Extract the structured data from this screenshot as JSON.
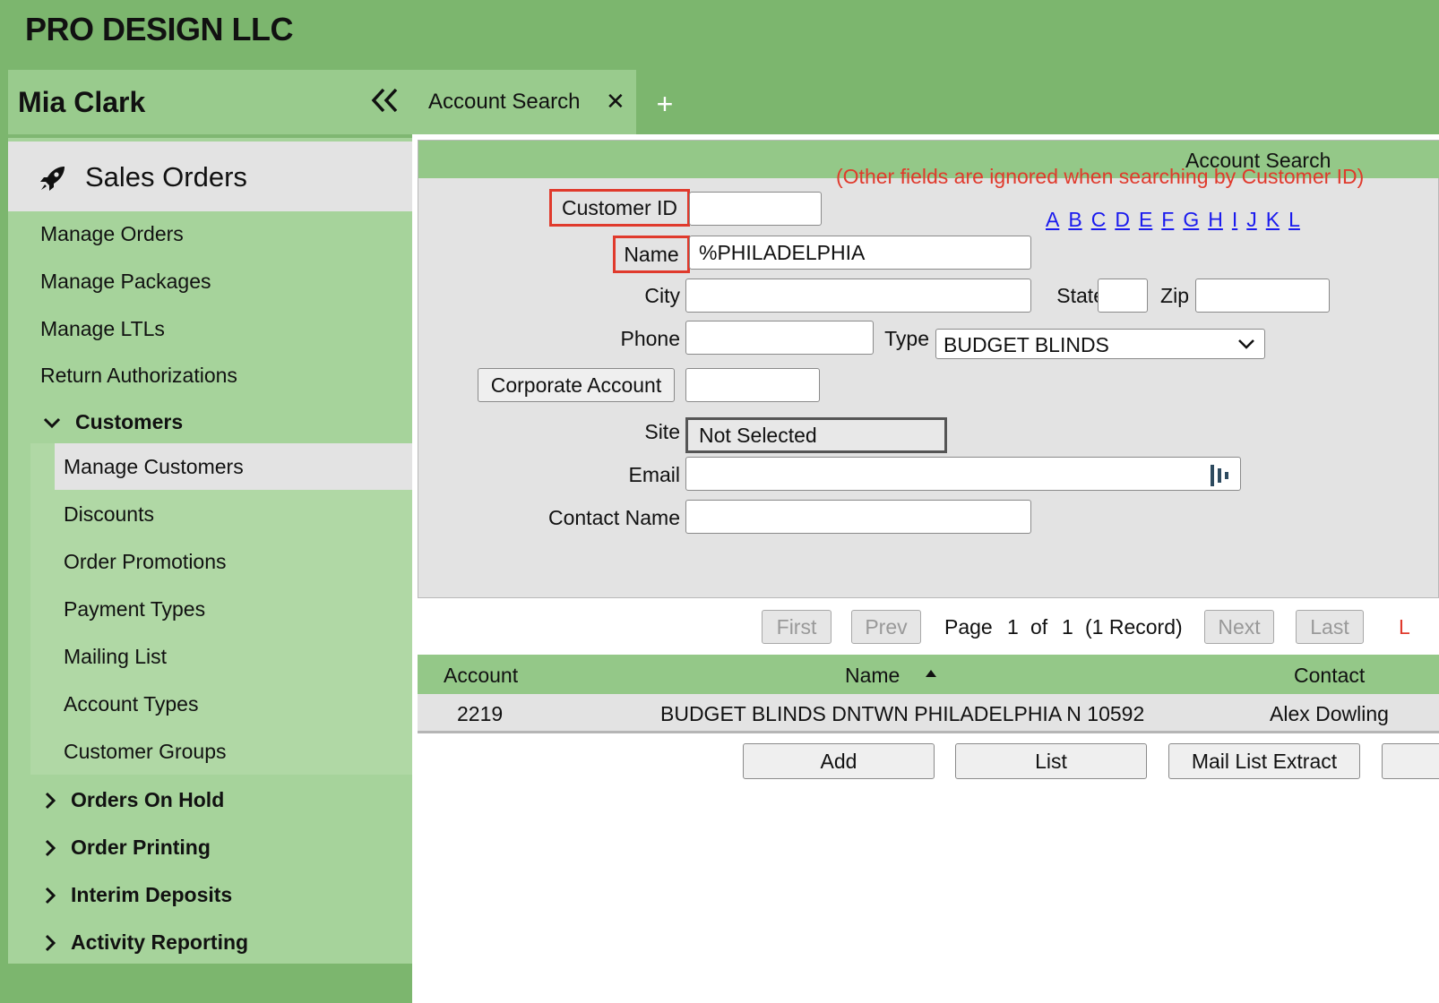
{
  "app": {
    "title": "PRO DESIGN LLC"
  },
  "sidebar": {
    "user_name": "Mia Clark",
    "section": "Sales Orders",
    "items": [
      "Manage Orders",
      "Manage Packages",
      "Manage LTLs",
      "Return Authorizations"
    ],
    "customers": {
      "label": "Customers",
      "items": [
        "Manage Customers",
        "Discounts",
        "Order Promotions",
        "Payment Types",
        "Mailing List",
        "Account Types",
        "Customer Groups"
      ],
      "active": "Manage Customers"
    },
    "groups": [
      "Orders On Hold",
      "Order Printing",
      "Interim Deposits",
      "Activity Reporting"
    ]
  },
  "tabs": [
    {
      "label": "Account Search",
      "close": "✕"
    }
  ],
  "tab_add": "+",
  "search": {
    "panel_title": "Account Search",
    "customer_id_label": "Customer ID",
    "customer_id_value": "",
    "customer_id_note": "(Other fields are ignored when searching by Customer ID)",
    "name_label": "Name",
    "name_value": "%PHILADELPHIA",
    "letters": [
      "A",
      "B",
      "C",
      "D",
      "E",
      "F",
      "G",
      "H",
      "I",
      "J",
      "K",
      "L"
    ],
    "city_label": "City",
    "state_label": "State",
    "zip_label": "Zip",
    "phone_label": "Phone",
    "type_label": "Type",
    "type_value": "BUDGET BLINDS",
    "corporate_account_label": "Corporate Account",
    "site_label": "Site",
    "site_value": "Not Selected",
    "email_label": "Email",
    "contact_name_label": "Contact Name"
  },
  "pager": {
    "first": "First",
    "prev": "Prev",
    "page_label": "Page",
    "page": "1",
    "of_label": "of",
    "total_pages": "1",
    "records": "(1 Record)",
    "next": "Next",
    "last": "Last",
    "cut_text": "L"
  },
  "table": {
    "columns": [
      "Account",
      "Name",
      "Contact"
    ],
    "rows": [
      {
        "account": "2219",
        "name": "BUDGET BLINDS DNTWN PHILADELPHIA N 10592",
        "contact": "Alex Dowling"
      }
    ]
  },
  "actions": {
    "add": "Add",
    "list": "List",
    "mail_list_extract": "Mail List Extract"
  },
  "colors": {
    "header_green": "#7cb66e",
    "sidebar_green": "#a6d39b",
    "highlight_red": "#e03a2c",
    "link_blue": "#1a1aee"
  }
}
